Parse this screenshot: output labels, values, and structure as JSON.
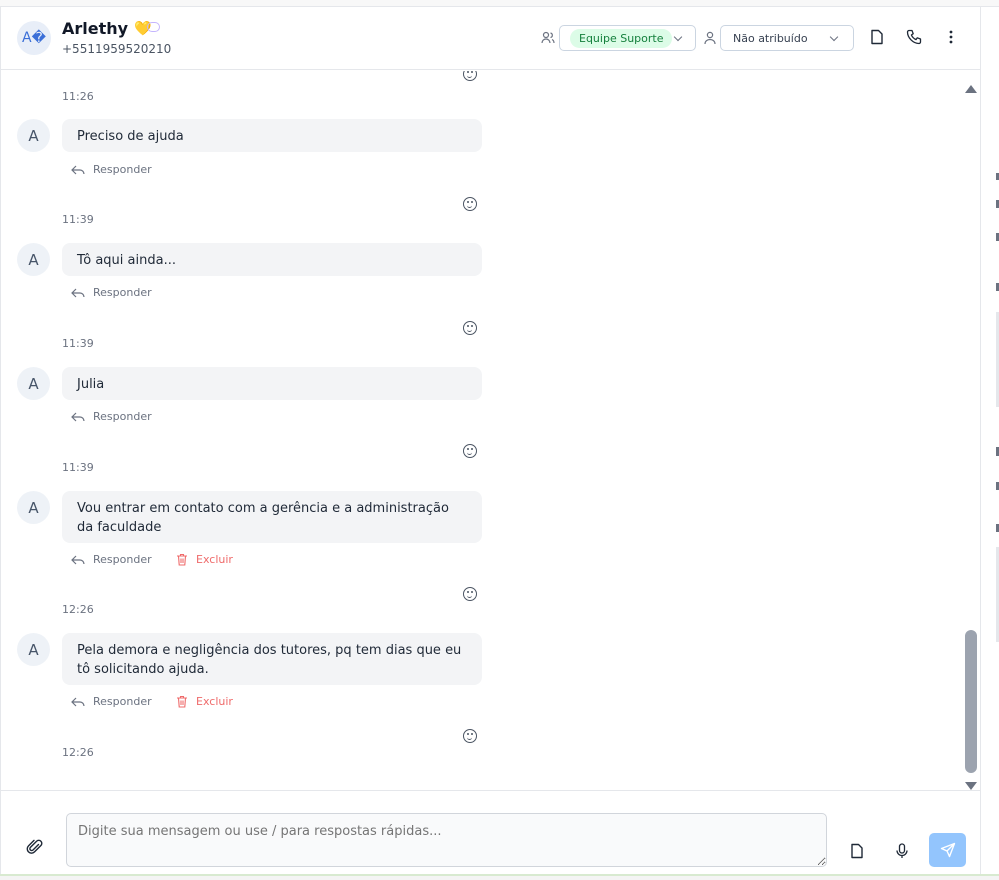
{
  "header": {
    "avatar_initials": "A�",
    "contact_name": "Arlethy",
    "contact_emoji": "💛",
    "contact_phone": "+5511959520210",
    "team_label": "Equipe Suporte",
    "assignee_label": "Não atribuído"
  },
  "messages": [
    {
      "avatar": "A",
      "text": "Preciso de ajuda",
      "time": "11:39",
      "reply": "Responder"
    },
    {
      "avatar": "A",
      "text": "Tô aqui ainda...",
      "time": "11:39",
      "reply": "Responder"
    },
    {
      "avatar": "A",
      "text": "Julia",
      "time": "11:39",
      "reply": "Responder"
    },
    {
      "avatar": "A",
      "text": "Vou entrar em contato com a gerência e a administração da faculdade",
      "time": "12:26",
      "reply": "Responder",
      "delete": "Excluir"
    },
    {
      "avatar": "A",
      "text": "Pela demora e negligência dos tutores, pq tem dias que eu tô solicitando ajuda.",
      "time": "12:26",
      "reply": "Responder",
      "delete": "Excluir"
    }
  ],
  "first_timestamp": "11:26",
  "composer": {
    "placeholder": "Digite sua mensagem ou use / para respostas rápidas..."
  },
  "colors": {
    "accent": "#93c5fd",
    "team_pill_bg": "#dcfce7",
    "team_pill_text": "#15803d",
    "delete_text": "#ef6b6b"
  }
}
